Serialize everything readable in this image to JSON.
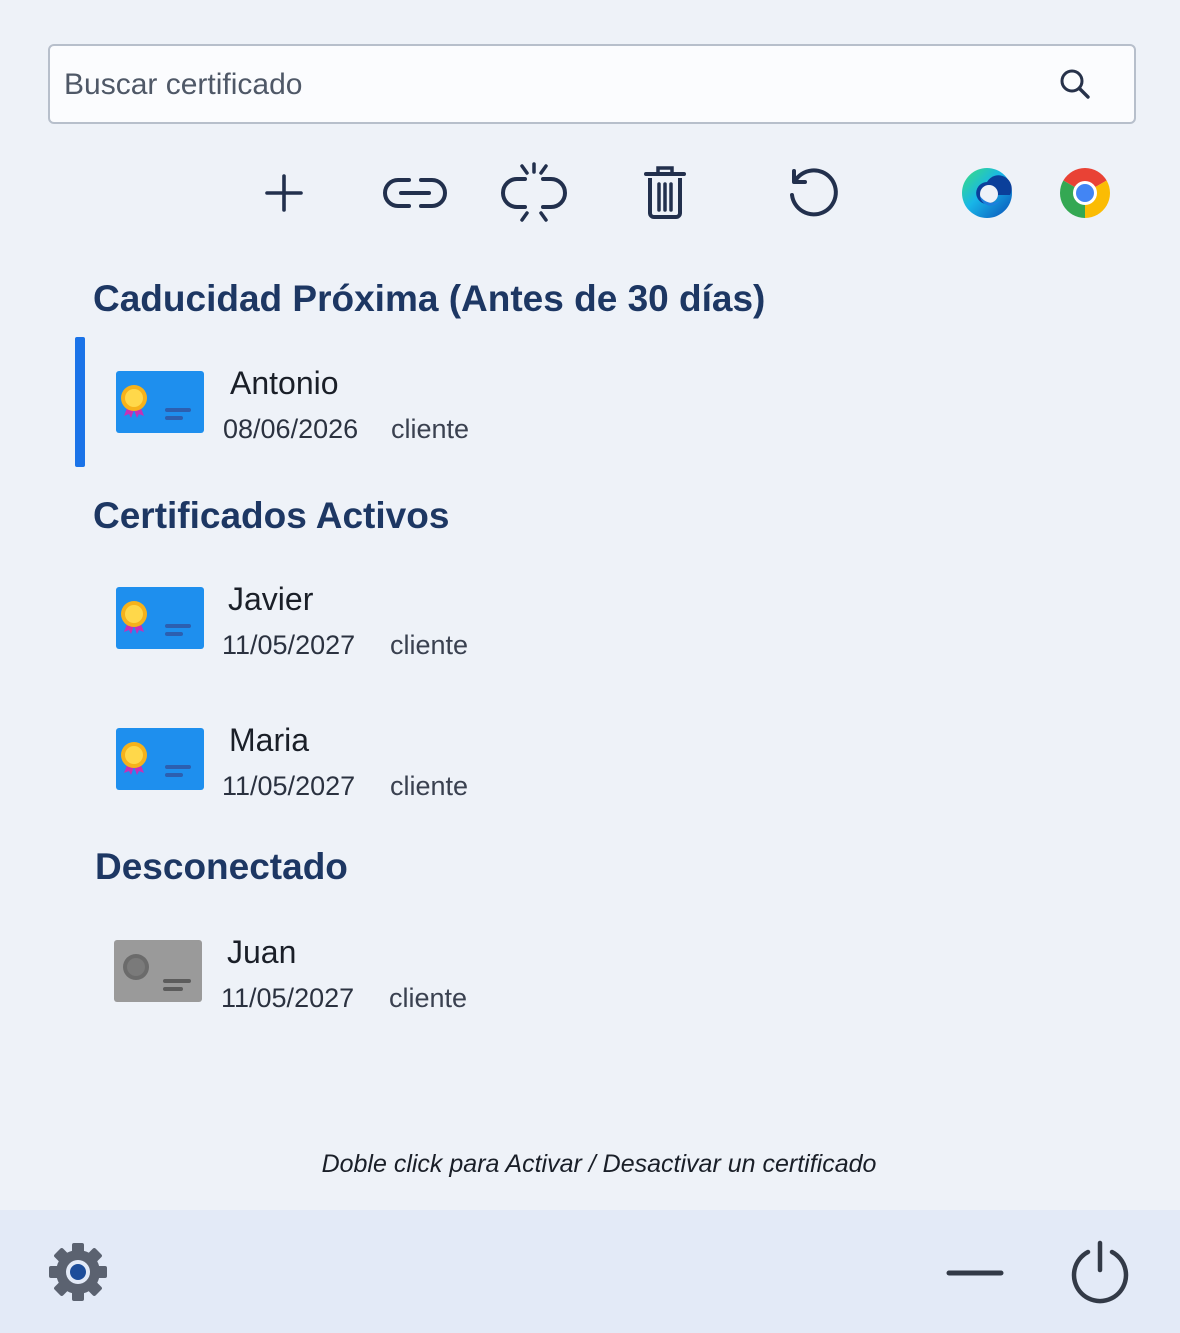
{
  "search": {
    "placeholder": "Buscar certificado",
    "value": ""
  },
  "toolbar": {
    "icons": [
      "plus-icon",
      "link-icon",
      "unlink-icon",
      "trash-icon",
      "refresh-icon",
      "edge-browser-icon",
      "chrome-browser-icon"
    ]
  },
  "sections": {
    "expiring": {
      "title": "Caducidad Próxima (Antes de 30 días)",
      "items": [
        {
          "name": "Antonio",
          "date": "08/06/2026",
          "role": "cliente",
          "icon": "certificate-icon",
          "selected": true
        }
      ]
    },
    "active": {
      "title": "Certificados Activos",
      "items": [
        {
          "name": "Javier",
          "date": "11/05/2027",
          "role": "cliente",
          "icon": "certificate-icon"
        },
        {
          "name": "Maria",
          "date": "11/05/2027",
          "role": "cliente",
          "icon": "certificate-icon"
        }
      ]
    },
    "disconnected": {
      "title": "Desconectado",
      "items": [
        {
          "name": "Juan",
          "date": "11/05/2027",
          "role": "cliente",
          "icon": "certificate-disabled-icon"
        }
      ]
    }
  },
  "hint": "Doble click para Activar / Desactivar un certificado",
  "bottom_bar": {
    "icons": [
      "settings-icon",
      "minimize-icon",
      "power-icon"
    ]
  },
  "colors": {
    "accent": "#1a73e8",
    "heading": "#1d3763",
    "background": "#eef2f8",
    "bottom_bar": "#e3eaf7",
    "certificate_active": "#1e8fee",
    "certificate_disabled": "#9a9a9a"
  }
}
